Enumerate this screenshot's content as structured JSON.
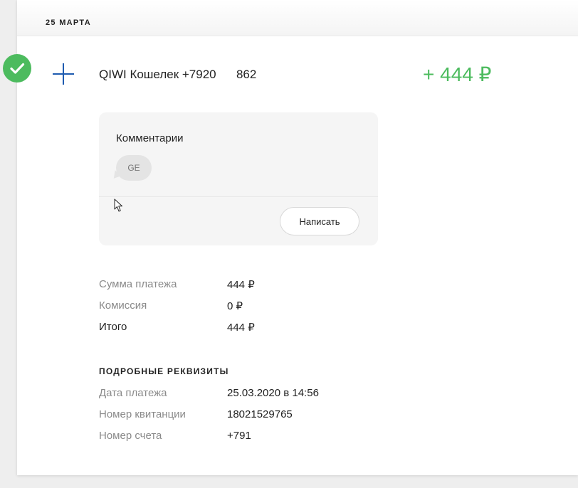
{
  "header": {
    "date": "25 МАРТА"
  },
  "transaction": {
    "title": "QIWI Кошелек +7920      862",
    "amount": "+ 444 ₽",
    "status_icon": "check-icon",
    "type_icon": "plus-icon"
  },
  "comments": {
    "title": "Комментарии",
    "bubble_text": "GE",
    "write_button": "Написать"
  },
  "summary": [
    {
      "label": "Сумма платежа",
      "value": "444 ₽"
    },
    {
      "label": "Комиссия",
      "value": "0 ₽"
    },
    {
      "label": "Итого",
      "value": "444 ₽"
    }
  ],
  "details": {
    "title": "ПОДРОБНЫЕ РЕКВИЗИТЫ",
    "rows": [
      {
        "label": "Дата платежа",
        "value": "25.03.2020 в 14:56"
      },
      {
        "label": "Номер квитанции",
        "value": "18021529765"
      },
      {
        "label": "Номер счета",
        "value": "+791"
      }
    ]
  },
  "colors": {
    "accent_green": "#4cbb5e",
    "plus_blue": "#1e5bb0",
    "panel_bg": "#f5f5f5"
  }
}
